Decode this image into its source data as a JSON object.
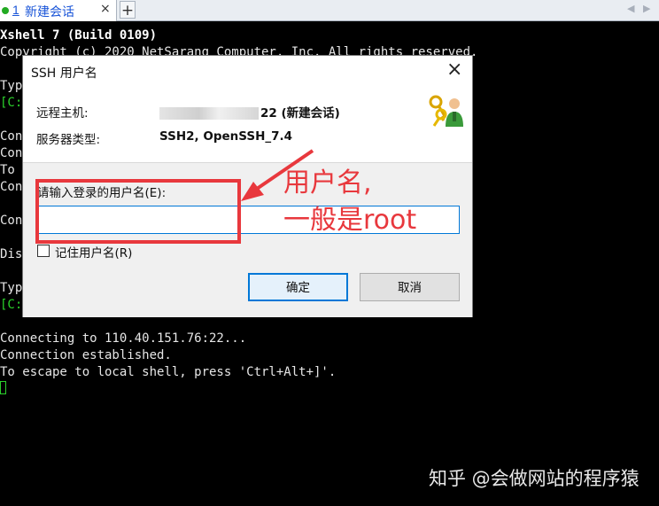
{
  "tabbar": {
    "tab_number": "1",
    "tab_label": "新建会话",
    "close_symbol": "×",
    "add_symbol": "+",
    "nav_prev": "◀",
    "nav_next": "▶"
  },
  "terminal": {
    "line1": "Xshell 7 (Build 0109)",
    "line2": "Copyright (c) 2020 NetSarang Computer, Inc. All rights reserved.",
    "partial": [
      "Typ",
      "[C:",
      "Con",
      "Con",
      "To",
      "Con",
      "Con",
      "Dis",
      "Typ",
      "[C:"
    ],
    "conn1": "Connecting to 110.40.151.76:22...",
    "conn2": "Connection established.",
    "conn3": "To escape to local shell, press 'Ctrl+Alt+]'.",
    "colors": {
      "background": "#000000",
      "text": "#e6e6e6",
      "prompt": "#2bd12b"
    }
  },
  "dialog": {
    "title": "SSH 用户名",
    "close_symbol": "×",
    "remote_host_label": "远程主机:",
    "remote_host_value": "22 (新建会话)",
    "server_type_label": "服务器类型:",
    "server_type_value": "SSH2, OpenSSH_7.4",
    "icon": "keys-user-icon",
    "prompt": "请输入登录的用户名(E):",
    "username_value": "",
    "remember_label": "记住用户名(R)",
    "remember_checked": false,
    "ok_label": "确定",
    "cancel_label": "取消"
  },
  "annotation": {
    "line1": "用户名,",
    "line2": "一般是root",
    "color": "#e8383d"
  },
  "watermark": "知乎 @会做网站的程序猿"
}
